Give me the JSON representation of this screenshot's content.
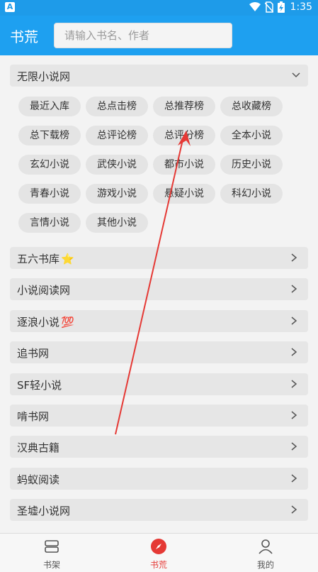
{
  "status": {
    "time": "1:35"
  },
  "appbar": {
    "title": "书荒",
    "search_placeholder": "请输入书名、作者"
  },
  "section": {
    "title": "无限小说网",
    "chips": [
      "最近入库",
      "总点击榜",
      "总推荐榜",
      "总收藏榜",
      "总下载榜",
      "总评论榜",
      "总评分榜",
      "全本小说",
      "玄幻小说",
      "武侠小说",
      "都市小说",
      "历史小说",
      "青春小说",
      "游戏小说",
      "悬疑小说",
      "科幻小说",
      "言情小说",
      "其他小说"
    ]
  },
  "sites": [
    {
      "label": "五六书库",
      "emoji": "⭐"
    },
    {
      "label": "小说阅读网",
      "emoji": ""
    },
    {
      "label": "逐浪小说",
      "emoji": "💯"
    },
    {
      "label": "追书网",
      "emoji": ""
    },
    {
      "label": "SF轻小说",
      "emoji": ""
    },
    {
      "label": "啃书网",
      "emoji": ""
    },
    {
      "label": "汉典古籍",
      "emoji": ""
    },
    {
      "label": "蚂蚁阅读",
      "emoji": ""
    },
    {
      "label": "圣墟小说网",
      "emoji": ""
    }
  ],
  "tabs": [
    {
      "label": "书架",
      "icon": "bookshelf-icon"
    },
    {
      "label": "书荒",
      "icon": "compass-icon",
      "active": true
    },
    {
      "label": "我的",
      "icon": "person-icon"
    }
  ],
  "colors": {
    "accent": "#1ea0f0",
    "active_tab": "#e53935",
    "annotation_arrow": "#e53935"
  }
}
